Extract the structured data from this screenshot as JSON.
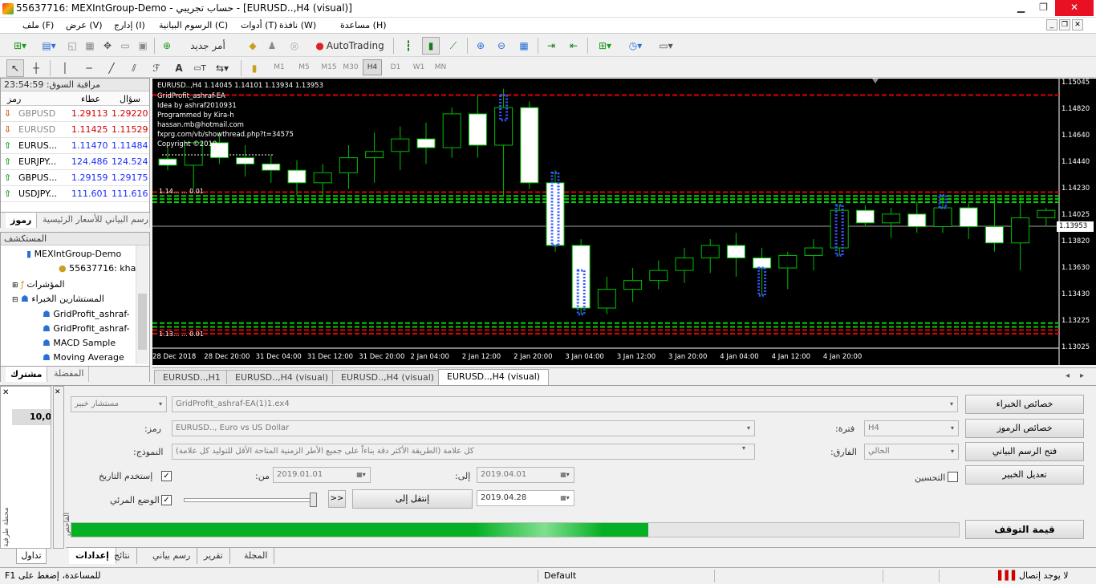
{
  "window": {
    "title": "55637716: MEXIntGroup-Demo - حساب تجريبي - [EURUSD..,H4 (visual)]"
  },
  "menu": [
    "ملف (F)",
    "عرض (V)",
    "إدارج (I)",
    "الرسوم البيانية (C)",
    "أدوات (T)",
    "نافذة (W)",
    "مساعدة (H)"
  ],
  "toolbar": {
    "new_order": "أمر جديد",
    "autotrading": "AutoTrading"
  },
  "timeframes": [
    "M1",
    "M5",
    "M15",
    "M30",
    "H1",
    "H4",
    "D1",
    "W1",
    "MN"
  ],
  "timeframe_selected": "H4",
  "market_watch": {
    "header": "مراقبة السوق: 23:54:59",
    "columns": [
      "رمز",
      "عطاء",
      "سؤال"
    ],
    "rows": [
      {
        "symbol": "GBPUSD",
        "bid": "1.29113",
        "ask": "1.29220",
        "dir": "down",
        "active": false
      },
      {
        "symbol": "EURUSD",
        "bid": "1.11425",
        "ask": "1.11529",
        "dir": "down",
        "active": false
      },
      {
        "symbol": "EURUS...",
        "bid": "1.11470",
        "ask": "1.11484",
        "dir": "up",
        "active": true
      },
      {
        "symbol": "EURJPY...",
        "bid": "124.486",
        "ask": "124.524",
        "dir": "up",
        "active": true
      },
      {
        "symbol": "GBPUS...",
        "bid": "1.29159",
        "ask": "1.29175",
        "dir": "up",
        "active": true
      },
      {
        "symbol": "USDJPY...",
        "bid": "111.601",
        "ask": "111.616",
        "dir": "up",
        "active": true
      }
    ],
    "tabs": [
      "رموز",
      "رسم البياني للأسعار الرئيسية"
    ]
  },
  "navigator": {
    "header": "المستكشف",
    "items": [
      "MEXIntGroup-Demo",
      "55637716: kha",
      "المؤشرات",
      "المستشارين الخبراء",
      "GridProfit_ashraf-",
      "GridProfit_ashraf-",
      "MACD Sample",
      "Moving Average"
    ],
    "tabs": [
      "مشترك",
      "المفضلة"
    ]
  },
  "chart": {
    "symbol_line": "EURUSD..,H4  1.14045 1.14101 1.13934 1.13953",
    "info": [
      "GridProfit_ashraf-EA",
      "Idea by ashraf2010931",
      "Programmed by Kira-h",
      "hassan.mb@hotmail.com",
      "fxprg.com/vb/showthread.php?t=34575",
      "Copyright ©2019"
    ],
    "grid_labels": [
      "1.14... ... 0.01",
      "1.13... ... 0.01"
    ],
    "current_price": "1.13953",
    "colors": {
      "bull": "#00c000",
      "bear": "#ffffff",
      "grid_red": "#e00000",
      "grid_green": "#00d000",
      "price_line": "#a0a0a0"
    }
  },
  "chart_data": {
    "type": "candlestick",
    "x_tick_labels": [
      "28 Dec 2018",
      "28 Dec 20:00",
      "31 Dec 04:00",
      "31 Dec 12:00",
      "31 Dec 20:00",
      "2 Jan 04:00",
      "2 Jan 12:00",
      "2 Jan 20:00",
      "3 Jan 04:00",
      "3 Jan 12:00",
      "3 Jan 20:00",
      "4 Jan 04:00",
      "4 Jan 12:00",
      "4 Jan 20:00"
    ],
    "y_tick_labels": [
      "1.15045",
      "1.14820",
      "1.14640",
      "1.14440",
      "1.14230",
      "1.14025",
      "1.13820",
      "1.13630",
      "1.13430",
      "1.13225",
      "1.13025"
    ],
    "ylim": [
      1.1298,
      1.1508
    ],
    "candles": [
      [
        1.1449,
        1.1458,
        1.144,
        1.1444
      ],
      [
        1.1444,
        1.1458,
        1.1425,
        1.1462
      ],
      [
        1.1462,
        1.147,
        1.1445,
        1.145
      ],
      [
        1.145,
        1.146,
        1.1435,
        1.1445
      ],
      [
        1.1445,
        1.1452,
        1.143,
        1.144
      ],
      [
        1.144,
        1.1448,
        1.142,
        1.143
      ],
      [
        1.143,
        1.1445,
        1.142,
        1.1438
      ],
      [
        1.1438,
        1.146,
        1.1425,
        1.145
      ],
      [
        1.145,
        1.147,
        1.143,
        1.1455
      ],
      [
        1.1455,
        1.1475,
        1.144,
        1.1465
      ],
      [
        1.1465,
        1.1478,
        1.1445,
        1.1458
      ],
      [
        1.1458,
        1.149,
        1.145,
        1.1485
      ],
      [
        1.1485,
        1.15,
        1.145,
        1.146
      ],
      [
        1.146,
        1.1505,
        1.142,
        1.149
      ],
      [
        1.149,
        1.1495,
        1.1425,
        1.143
      ],
      [
        1.143,
        1.144,
        1.1375,
        1.138
      ],
      [
        1.138,
        1.1385,
        1.1325,
        1.133
      ],
      [
        1.133,
        1.1355,
        1.1325,
        1.1345
      ],
      [
        1.1345,
        1.1362,
        1.1335,
        1.1352
      ],
      [
        1.1352,
        1.1368,
        1.1345,
        1.136
      ],
      [
        1.136,
        1.1378,
        1.135,
        1.137
      ],
      [
        1.137,
        1.1385,
        1.1358,
        1.138
      ],
      [
        1.138,
        1.139,
        1.1355,
        1.137
      ],
      [
        1.137,
        1.1378,
        1.134,
        1.1362
      ],
      [
        1.1362,
        1.1375,
        1.1345,
        1.1372
      ],
      [
        1.1372,
        1.1385,
        1.136,
        1.1378
      ],
      [
        1.1378,
        1.1412,
        1.1372,
        1.1408
      ],
      [
        1.1408,
        1.1412,
        1.1395,
        1.1398
      ],
      [
        1.1398,
        1.141,
        1.1386,
        1.1405
      ],
      [
        1.1405,
        1.1415,
        1.139,
        1.1395
      ],
      [
        1.1395,
        1.142,
        1.139,
        1.141
      ],
      [
        1.141,
        1.1415,
        1.1385,
        1.1395
      ],
      [
        1.1395,
        1.1418,
        1.1375,
        1.1382
      ],
      [
        1.1382,
        1.142,
        1.136,
        1.1402
      ],
      [
        1.1402,
        1.141,
        1.1395,
        1.1408
      ]
    ]
  },
  "chart_tabs": [
    "EURUSD..,H1",
    "EURUSD..,H4 (visual)",
    "EURUSD..,H4 (visual)",
    "EURUSD..,H4 (visual)"
  ],
  "tester": {
    "expert_type": "مستشار خبير",
    "expert_file": "GridProfit_ashraf-EA(1)1.ex4",
    "symbol_label": ":رمز",
    "symbol_value": "EURUSD.., Euro vs US Dollar",
    "model_label": ":النموذج",
    "model_value": "كل علامة (الطريقة الأكثر دقة بناءاً على جميع الأطر الزمنية المتاحة الأقل للتوليد كل علامة)",
    "period_label": ":فترة",
    "period_value": "H4",
    "spread_label": ":الفارق",
    "spread_value": "الحالي",
    "use_date": "إستخدم التاريخ",
    "from_label": ":من",
    "from_value": "2019.01.01",
    "to_label": ":إلى",
    "to_value": "2019.04.01",
    "visual": "الوضع المرئي",
    "skip_to": "إنتقل إلى",
    "skip_date": "2019.04.28",
    "forward": ">>",
    "optimize": "التحسين",
    "btn_expert_props": "خصائص الخبراء",
    "btn_symbol_props": "خصائص الرموز",
    "btn_open_chart": "فتح الرسم البياني",
    "btn_modify_expert": "تعديل الخبير",
    "btn_stop": "قيمة التوقف",
    "progress": 0.65,
    "tabs": [
      "إعدادات",
      "نتائج",
      "رسم بياني",
      "تقرير",
      "المجلة"
    ],
    "side_value": "10,0",
    "side_tab": "تداول",
    "side_label_a": "الفاحص",
    "side_label_b": "محطة طرفية"
  },
  "status": {
    "help": "F1 للمساعدة، إضغط على",
    "profile": "Default",
    "connection": "لا يوجد إتصال"
  }
}
